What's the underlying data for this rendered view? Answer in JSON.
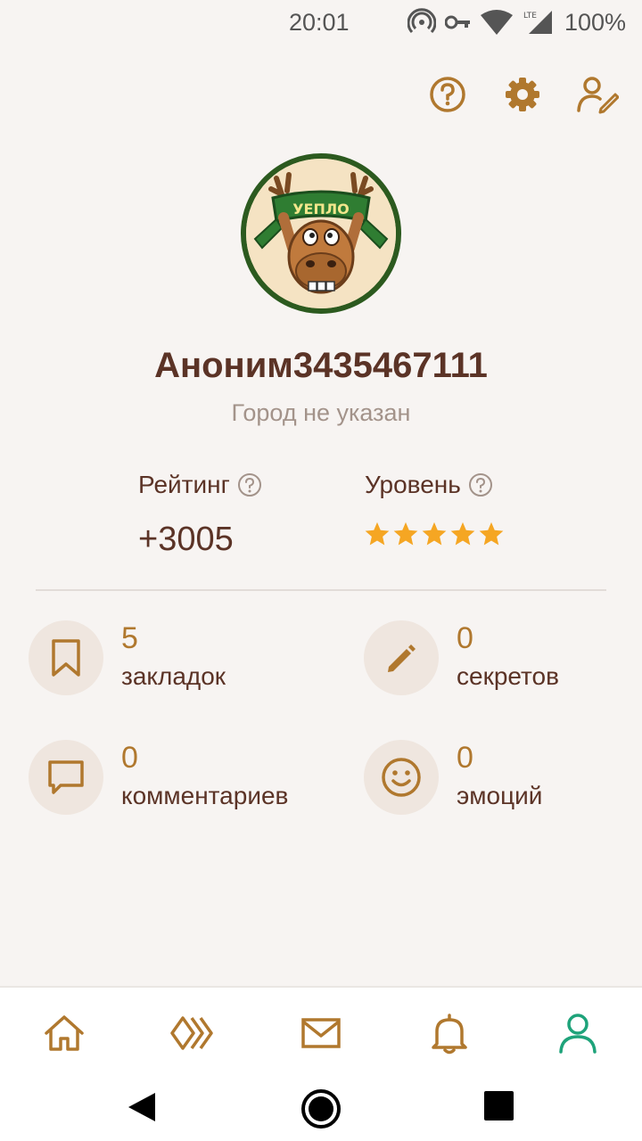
{
  "status_bar": {
    "time": "20:01",
    "battery": "100%",
    "network": "LTE"
  },
  "profile": {
    "username": "Аноним3435467111",
    "city": "Город не указан",
    "avatar_banner": "УЕПЛО"
  },
  "rating": {
    "label": "Рейтинг",
    "value": "+3005"
  },
  "level": {
    "label": "Уровень",
    "stars": 5
  },
  "stats": [
    {
      "count": "5",
      "label": "закладок",
      "icon": "bookmark-icon"
    },
    {
      "count": "0",
      "label": "секретов",
      "icon": "pencil-icon"
    },
    {
      "count": "0",
      "label": "комментариев",
      "icon": "comment-icon"
    },
    {
      "count": "0",
      "label": "эмоций",
      "icon": "smiley-icon"
    }
  ],
  "top_actions": [
    "help-icon",
    "gear-icon",
    "edit-profile-icon"
  ],
  "bottom_nav": [
    "home-icon",
    "feed-icon",
    "mail-icon",
    "bell-icon",
    "profile-icon"
  ],
  "colors": {
    "accent": "#b0782e",
    "text_dark": "#5b3326",
    "muted": "#a3938a",
    "active_tab": "#1ea37a",
    "star": "#f5a623",
    "icon_bg": "#efe6df"
  }
}
